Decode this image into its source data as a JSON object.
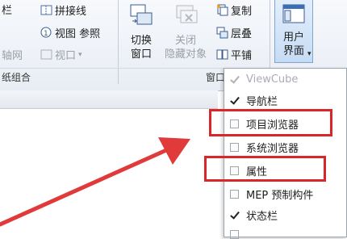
{
  "ribbon": {
    "left_col": {
      "top_left": "栏",
      "middle_left": "轴网",
      "panel_title": "纸组合"
    },
    "stitch_line_label": "拼接线",
    "view_ref_label": "视图 参照",
    "viewport_label": "视口",
    "switch_window": {
      "line1": "切换",
      "line2": "窗口"
    },
    "close_hidden": {
      "line1": "关闭",
      "line2": "隐藏对象"
    },
    "copy_label": "复制",
    "cascade_label": "层叠",
    "tile_label": "平铺",
    "user_interface": {
      "line1": "用户",
      "line2": "界面"
    },
    "window_panel_title": "窗口"
  },
  "dropdown": {
    "items": [
      {
        "label": "ViewCube",
        "checked": true,
        "enabled": false
      },
      {
        "label": "导航栏",
        "checked": true,
        "enabled": true
      },
      {
        "label": "项目浏览器",
        "checked": false,
        "enabled": true
      },
      {
        "label": "系统浏览器",
        "checked": false,
        "enabled": true
      },
      {
        "label": "属性",
        "checked": false,
        "enabled": true
      },
      {
        "label": "MEP 预制构件",
        "checked": false,
        "enabled": true
      },
      {
        "label": "状态栏",
        "checked": true,
        "enabled": true
      }
    ]
  },
  "colors": {
    "highlight": "#d9262b",
    "arrow": "#e03a3a"
  },
  "icons": [
    "stitch-line-icon",
    "view-ref-icon",
    "viewport-icon",
    "switch-window-icon",
    "close-hidden-icon",
    "copy-icon",
    "cascade-icon",
    "tile-icon",
    "user-interface-icon"
  ]
}
